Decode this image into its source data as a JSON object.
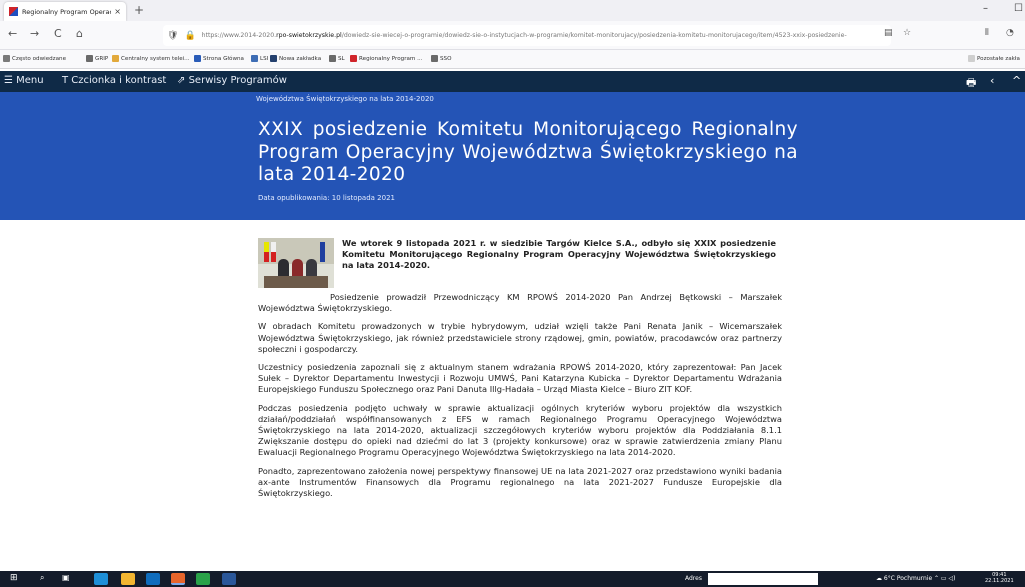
{
  "browser": {
    "tab_title": "Regionalny Program Operacyjn",
    "tab_close": "×",
    "new_tab": "+",
    "back": "←",
    "forward": "→",
    "reload": "C",
    "home": "⌂",
    "url_prefix": "https://www.2014-2020.",
    "url_domain": "rpo-swietokrzyskie.pl",
    "url_path": "/dowiedz-sie-wiecej-o-programie/dowiedz-sie-o-instytucjach-w-programie/komitet-monitorujacy/posiedzenia-komitetu-monitorujacego/item/4523-xxix-posiedzenie-",
    "win_min": "–",
    "win_max": "☐"
  },
  "bookmarks": [
    {
      "label": "Często odwiedzane",
      "color": "#7a7a7a"
    },
    {
      "label": "GRIP",
      "color": "#6a6a6a"
    },
    {
      "label": "Centralny system telei...",
      "color": "#e2a93b"
    },
    {
      "label": "Strona Główna",
      "color": "#2a5cb8"
    },
    {
      "label": "LSI",
      "color": "#3e6db5"
    },
    {
      "label": "Nowa zakładka",
      "color": "#24406e"
    },
    {
      "label": "SL",
      "color": "#6a6a6a"
    },
    {
      "label": "Regionalny Program ...",
      "color": "#d0242a"
    },
    {
      "label": "SSO",
      "color": "#6a6a6a"
    }
  ],
  "bookmarks_other": "Pozostałe zakła",
  "site_toolbar": {
    "menu": "Menu",
    "font": "Czcionka i kontrast",
    "services": "Serwisy Programów"
  },
  "banner": {
    "breadcrumb": "Województwa Świętokrzyskiego na lata 2014-2020",
    "title": "XXIX posiedzenie Komitetu Monitorującego Regionalny Program Operacyjny Województwa Świętokrzyskiego na lata 2014-2020",
    "published": "Data opublikowania: 10 listopada 2021"
  },
  "article": {
    "lead": "We wtorek 9 listopada 2021 r. w siedzibie Targów Kielce S.A., odbyło się XXIX posiedzenie Komitetu Monitorującego Regionalny Program Operacyjny Województwa Świętokrzyskiego na lata 2014-2020.",
    "p1": "Posiedzenie prowadził Przewodniczący KM RPOWŚ 2014-2020 Pan Andrzej Bętkowski – Marszałek Województwa Świętokrzyskiego.",
    "p2": "W obradach Komitetu prowadzonych w trybie hybrydowym, udział wzięli także Pani Renata Janik – Wicemarszałek Województwa Świętokrzyskiego, jak również przedstawiciele strony rządowej, gmin, powiatów, pracodawców oraz partnerzy społeczni i gospodarczy.",
    "p3": "Uczestnicy posiedzenia zapoznali się z aktualnym stanem wdrażania RPOWŚ 2014-2020, który zaprezentował: Pan Jacek Sułek – Dyrektor Departamentu Inwestycji i Rozwoju UMWŚ, Pani Katarzyna Kubicka – Dyrektor Departamentu Wdrażania Europejskiego Funduszu Społecznego oraz Pani Danuta Illg-Hadała – Urząd Miasta Kielce – Biuro ZIT KOF.",
    "p4": "Podczas posiedzenia podjęto uchwały w sprawie aktualizacji ogólnych kryteriów wyboru projektów dla wszystkich działań/poddziałań współfinansowanych z EFS w ramach Regionalnego Programu Operacyjnego Województwa Świętokrzyskiego na lata 2014-2020, aktualizacji szczegółowych kryteriów wyboru projektów dla Poddziałania 8.1.1 Zwiększanie dostępu do opieki nad dziećmi do lat 3 (projekty konkursowe) oraz w sprawie zatwierdzenia zmiany Planu Ewaluacji Regionalnego Programu Operacyjnego Województwa Świętokrzyskiego na lata 2014-2020.",
    "p5": "Ponadto, zaprezentowano założenia nowej perspektywy finansowej UE na lata 2021-2027 oraz przedstawiono wyniki badania ax-ante Instrumentów Finansowych dla Programu regionalnego na lata 2021-2027 Fundusze Europejskie dla Świętokrzyskiego."
  },
  "taskbar": {
    "address_label": "Adres",
    "weather": "6°C Pochmurnie",
    "time": "09:41",
    "date": "22.11.2021",
    "accent": "#141c2b"
  },
  "colors": {
    "banner": "#2454b6",
    "site_toolbar": "#0f2a47"
  }
}
